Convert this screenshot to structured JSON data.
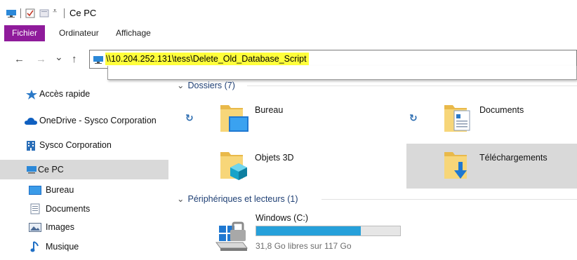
{
  "window": {
    "title": "Ce PC"
  },
  "ribbon": {
    "tabs": [
      "Fichier",
      "Ordinateur",
      "Affichage"
    ]
  },
  "nav": {
    "back": "←",
    "forward": "→",
    "recent": "⌄",
    "up": "↑",
    "address": "\\\\10.204.252.131\\tess\\Delete_Old_Database_Script"
  },
  "sidebar": {
    "items": [
      {
        "label": "Accès rapide",
        "icon": "star-icon"
      },
      {
        "label": "OneDrive - Sysco Corporation",
        "icon": "cloud-icon"
      },
      {
        "label": "Sysco Corporation",
        "icon": "building-icon"
      },
      {
        "label": "Ce PC",
        "icon": "computer-icon",
        "selected": true
      },
      {
        "label": "Bureau",
        "icon": "desktop-icon"
      },
      {
        "label": "Documents",
        "icon": "document-icon"
      },
      {
        "label": "Images",
        "icon": "image-icon"
      },
      {
        "label": "Musique",
        "icon": "music-icon"
      }
    ]
  },
  "content": {
    "folders_header": "Dossiers (7)",
    "folders": [
      {
        "label": "Bureau",
        "sync": true
      },
      {
        "label": "Documents",
        "sync": true
      },
      {
        "label": "Objets 3D",
        "sync": false
      },
      {
        "label": "Téléchargements",
        "sync": false,
        "selected": true
      }
    ],
    "devices_header": "Périphériques et lecteurs (1)",
    "drive": {
      "label": "Windows (C:)",
      "free_text": "31,8 Go libres sur 117 Go",
      "used_fraction": 0.728
    }
  },
  "colors": {
    "file_tab": "#8f1b9b",
    "highlight": "#ffff3b",
    "selection": "#d9d9d9",
    "drive_fill": "#26a0da",
    "header_text": "#1e3f74"
  }
}
